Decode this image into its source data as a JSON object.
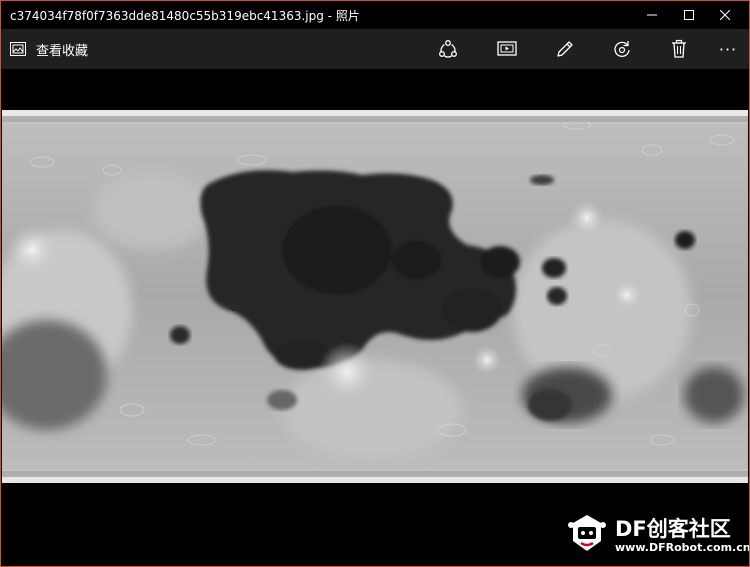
{
  "window": {
    "title": "c374034f78f0f7363dde81480c55b319ebc41363.jpg - 照片",
    "border_color": "#c9523b"
  },
  "toolbar": {
    "collection_label": "查看收藏",
    "collection_icon": "photos-collection-icon",
    "share_icon": "share-icon",
    "slideshow_icon": "slideshow-icon",
    "edit_icon": "edit-pencil-icon",
    "rotate_icon": "rotate-icon",
    "delete_icon": "trash-icon",
    "more_label": "···",
    "background": "#1f1f1f"
  },
  "photo": {
    "subject": "lunar-map-image"
  },
  "watermark": {
    "title": "DF创客社区",
    "url": "www.DFRobot.com.cn",
    "logo_icon": "dfrobot-logo-icon"
  }
}
